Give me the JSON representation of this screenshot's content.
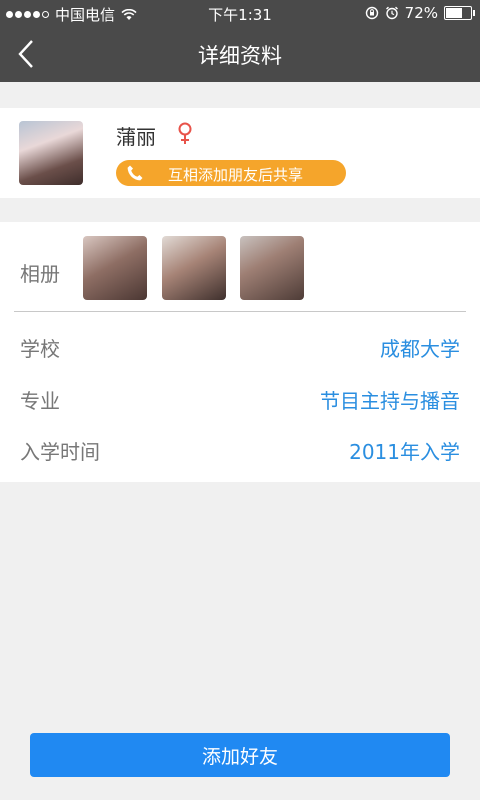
{
  "status_bar": {
    "carrier": "中国电信",
    "time": "下午1:31",
    "battery_text": "72%",
    "battery_level": 0.72,
    "signal_bars_filled": 4,
    "icons": [
      "wifi-icon",
      "rotation-lock-icon",
      "alarm-icon",
      "battery-icon"
    ]
  },
  "nav": {
    "title": "详细资料",
    "back_icon": "chevron-left-icon"
  },
  "profile": {
    "name": "蒲丽",
    "gender_icon": "female-icon",
    "share_text": "互相添加朋友后共享",
    "share_icon": "phone-icon"
  },
  "details": {
    "album_label": "相册",
    "rows": [
      {
        "label": "学校",
        "value": "成都大学"
      },
      {
        "label": "专业",
        "value": "节目主持与播音"
      },
      {
        "label": "入学时间",
        "value": "2011年入学"
      }
    ]
  },
  "footer": {
    "add_friend_label": "添加好友"
  },
  "colors": {
    "bar_bg": "#4a4a4a",
    "accent_blue": "#2089f2",
    "value_blue": "#2a8ee0",
    "pill_orange": "#f5a52b",
    "female_red": "#e8534a"
  }
}
